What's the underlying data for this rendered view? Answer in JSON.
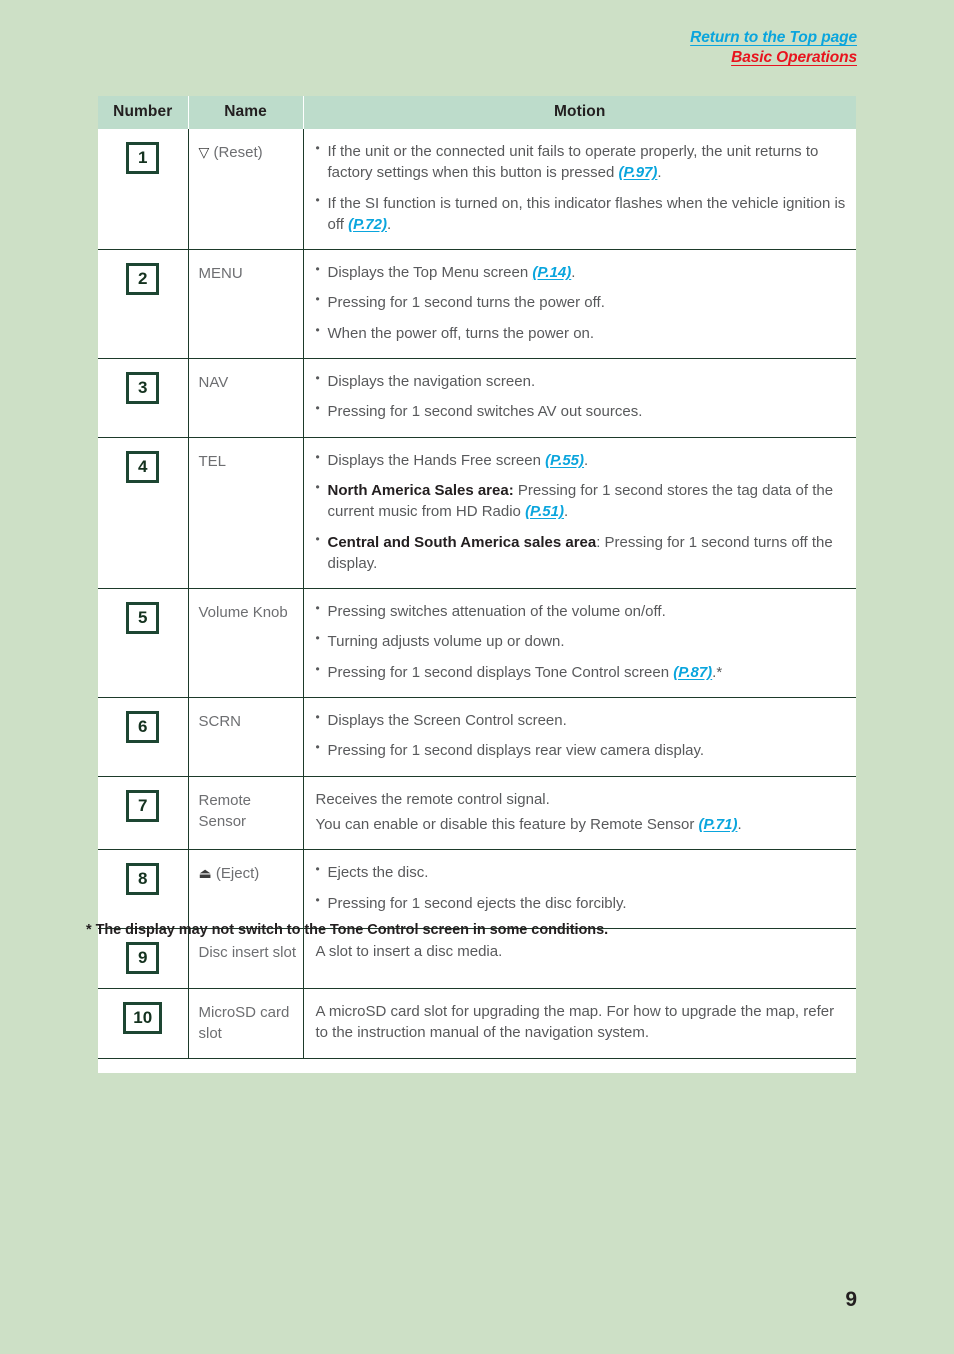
{
  "header": {
    "return_link": "Return to the Top page",
    "section_link": "Basic Operations",
    "link_color": "#0aa5dd",
    "section_color": "#e8141e"
  },
  "table": {
    "columns": [
      "Number",
      "Name",
      "Motion"
    ],
    "rows": [
      {
        "number": "1",
        "name_symbol": "▽",
        "name": "▽ (Reset)",
        "motion_type": "bullets",
        "motion": [
          {
            "parts": [
              {
                "t": "If the unit or the connected unit fails to operate properly, the unit returns to factory settings when this button is pressed ",
                "s": "plain"
              },
              {
                "t": "(P.97)",
                "s": "pref"
              },
              {
                "t": ".",
                "s": "plain"
              }
            ]
          },
          {
            "parts": [
              {
                "t": "If the SI function is turned on, this indicator flashes when the vehicle ignition is off ",
                "s": "plain"
              },
              {
                "t": "(P.72)",
                "s": "pref"
              },
              {
                "t": ".",
                "s": "plain"
              }
            ]
          }
        ]
      },
      {
        "number": "2",
        "name": "MENU",
        "motion_type": "bullets",
        "motion": [
          {
            "parts": [
              {
                "t": "Displays the Top Menu screen ",
                "s": "plain"
              },
              {
                "t": "(P.14)",
                "s": "pref"
              },
              {
                "t": ".",
                "s": "plain"
              }
            ]
          },
          {
            "parts": [
              {
                "t": "Pressing for 1 second turns the power off.",
                "s": "plain"
              }
            ]
          },
          {
            "parts": [
              {
                "t": "When the power off, turns the power on.",
                "s": "plain"
              }
            ]
          }
        ]
      },
      {
        "number": "3",
        "name": "NAV",
        "motion_type": "bullets",
        "motion": [
          {
            "parts": [
              {
                "t": "Displays the navigation screen.",
                "s": "plain"
              }
            ]
          },
          {
            "parts": [
              {
                "t": "Pressing for 1 second switches AV out sources.",
                "s": "plain"
              }
            ]
          }
        ]
      },
      {
        "number": "4",
        "name": "TEL",
        "motion_type": "bullets",
        "motion": [
          {
            "parts": [
              {
                "t": "Displays the Hands Free screen ",
                "s": "plain"
              },
              {
                "t": "(P.55)",
                "s": "pref"
              },
              {
                "t": ".",
                "s": "plain"
              }
            ]
          },
          {
            "parts": [
              {
                "t": "North America Sales area:",
                "s": "strong"
              },
              {
                "t": " Pressing for 1 second stores the tag data of the current music from HD Radio ",
                "s": "plain"
              },
              {
                "t": "(P.51)",
                "s": "pref"
              },
              {
                "t": ".",
                "s": "plain"
              }
            ]
          },
          {
            "parts": [
              {
                "t": "Central and South America sales area",
                "s": "strong"
              },
              {
                "t": ": Pressing for 1 second turns off the display.",
                "s": "plain"
              }
            ]
          }
        ]
      },
      {
        "number": "5",
        "name": "Volume Knob",
        "motion_type": "bullets",
        "motion": [
          {
            "parts": [
              {
                "t": "Pressing switches attenuation of the volume on/off.",
                "s": "plain"
              }
            ]
          },
          {
            "parts": [
              {
                "t": "Turning adjusts volume up or down.",
                "s": "plain"
              }
            ]
          },
          {
            "parts": [
              {
                "t": "Pressing for 1 second displays Tone Control screen ",
                "s": "plain"
              },
              {
                "t": "(P.87)",
                "s": "pref"
              },
              {
                "t": ".*",
                "s": "plain"
              }
            ]
          }
        ]
      },
      {
        "number": "6",
        "name": "SCRN",
        "motion_type": "bullets",
        "motion": [
          {
            "parts": [
              {
                "t": "Displays the Screen Control screen.",
                "s": "plain"
              }
            ]
          },
          {
            "parts": [
              {
                "t": "Pressing for 1 second displays rear view camera display.",
                "s": "plain"
              }
            ]
          }
        ]
      },
      {
        "number": "7",
        "name": "Remote Sensor",
        "motion_type": "plain",
        "motion": [
          {
            "parts": [
              {
                "t": "Receives the remote control signal.",
                "s": "plain"
              }
            ]
          },
          {
            "parts": [
              {
                "t": "You can enable or disable this feature by Remote Sensor ",
                "s": "plain"
              },
              {
                "t": "(P.71)",
                "s": "pref"
              },
              {
                "t": ".",
                "s": "plain"
              }
            ]
          }
        ]
      },
      {
        "number": "8",
        "name_symbol": "⏏",
        "name": "⏏ (Eject)",
        "motion_type": "bullets",
        "motion": [
          {
            "parts": [
              {
                "t": "Ejects the disc.",
                "s": "plain"
              }
            ]
          },
          {
            "parts": [
              {
                "t": "Pressing for 1 second ejects the disc forcibly.",
                "s": "plain"
              }
            ]
          }
        ]
      },
      {
        "number": "9",
        "name": "Disc insert slot",
        "motion_type": "plain",
        "motion": [
          {
            "parts": [
              {
                "t": "A slot to insert a disc media.",
                "s": "plain"
              }
            ]
          }
        ]
      },
      {
        "number": "10",
        "name": "MicroSD card slot",
        "motion_type": "plain",
        "motion": [
          {
            "parts": [
              {
                "t": "A microSD card slot for upgrading the map. For how to upgrade the map, refer to the instruction manual of the navigation system.",
                "s": "plain"
              }
            ]
          }
        ]
      }
    ]
  },
  "footnote": "* The display may not switch to the Tone Control screen in some conditions.",
  "page_number": "9"
}
